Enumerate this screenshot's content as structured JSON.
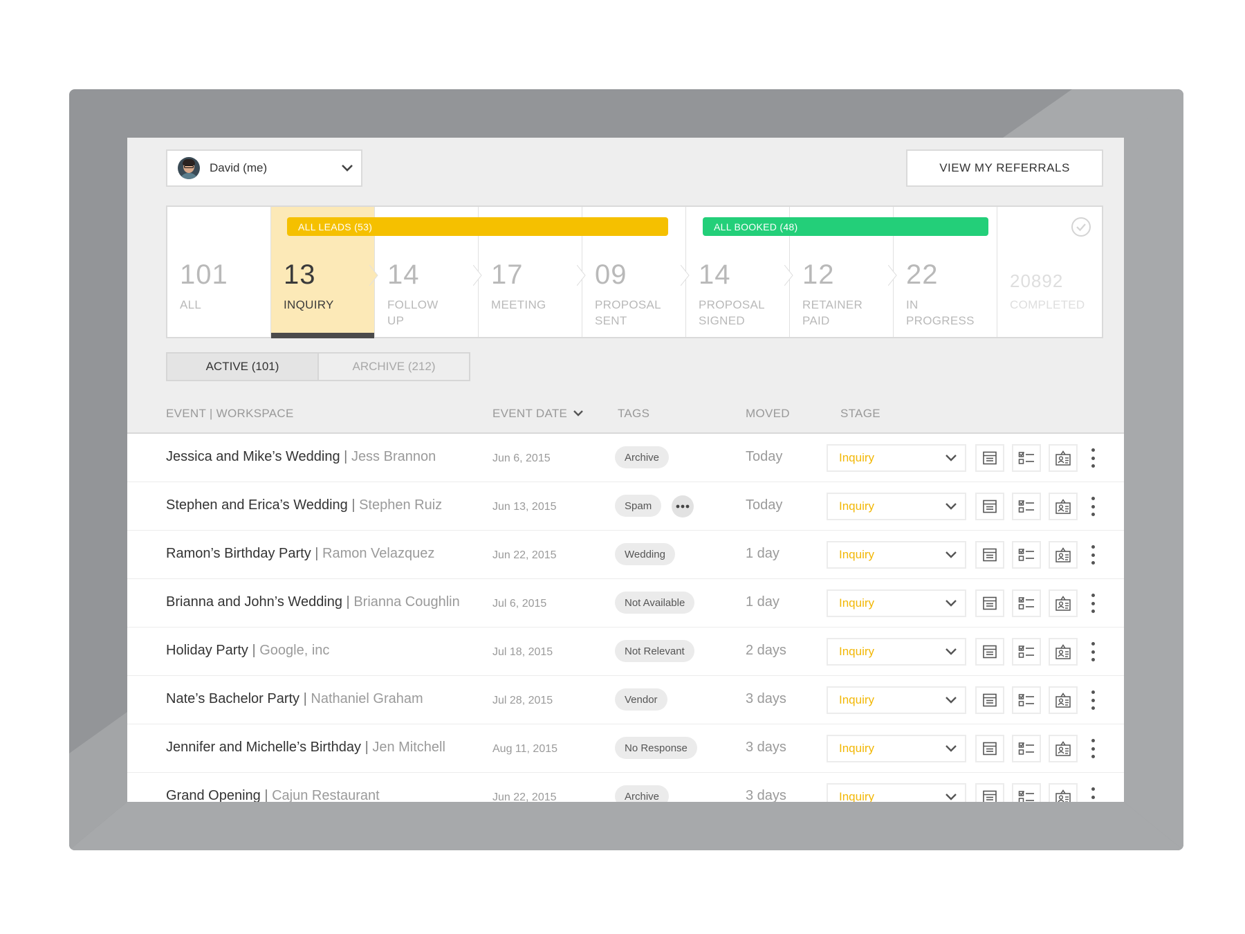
{
  "user": {
    "name": "David (me)"
  },
  "header": {
    "referrals_label": "VIEW MY REFERRALS"
  },
  "groups": {
    "leads": "ALL LEADS (53)",
    "booked": "ALL BOOKED (48)"
  },
  "stages": [
    {
      "count": "101",
      "label": "ALL"
    },
    {
      "count": "13",
      "label": "INQUIRY"
    },
    {
      "count": "14",
      "label": "FOLLOW UP"
    },
    {
      "count": "17",
      "label": "MEETING"
    },
    {
      "count": "09",
      "label": "PROPOSAL SENT"
    },
    {
      "count": "14",
      "label": "PROPOSAL SIGNED"
    },
    {
      "count": "12",
      "label": "RETAINER PAID"
    },
    {
      "count": "22",
      "label": "IN PROGRESS"
    },
    {
      "count": "20892",
      "label": "COMPLETED"
    }
  ],
  "toggle": {
    "active": "ACTIVE (101)",
    "archive": "ARCHIVE (212)"
  },
  "columns": {
    "event": "EVENT | WORKSPACE",
    "date": "EVENT DATE",
    "tags": "TAGS",
    "moved": "MOVED",
    "stage": "STAGE"
  },
  "rows": [
    {
      "event": "Jessica and Mike’s Wedding",
      "sep": " | ",
      "workspace": "Jess Brannon",
      "date": "Jun 6, 2015",
      "tag": "Archive",
      "moved": "Today",
      "stage": "Inquiry"
    },
    {
      "event": "Stephen and Erica’s Wedding",
      "sep": " | ",
      "workspace": "Stephen Ruiz",
      "date": "Jun 13, 2015",
      "tag": "Spam",
      "moved": "Today",
      "stage": "Inquiry"
    },
    {
      "event": "Ramon’s Birthday Party",
      "sep": " | ",
      "workspace": "Ramon Velazquez",
      "date": "Jun 22, 2015",
      "tag": "Wedding",
      "moved": "1 day",
      "stage": "Inquiry"
    },
    {
      "event": "Brianna and John’s Wedding",
      "sep": " | ",
      "workspace": "Brianna Coughlin",
      "date": "Jul 6, 2015",
      "tag": "Not Available",
      "moved": "1 day",
      "stage": "Inquiry"
    },
    {
      "event": "Holiday Party",
      "sep": " | ",
      "workspace": "Google, inc",
      "date": "Jul 18, 2015",
      "tag": "Not Relevant",
      "moved": "2 days",
      "stage": "Inquiry"
    },
    {
      "event": "Nate’s Bachelor Party",
      "sep": " | ",
      "workspace": "Nathaniel Graham",
      "date": "Jul 28, 2015",
      "tag": "Vendor",
      "moved": "3 days",
      "stage": "Inquiry"
    },
    {
      "event": "Jennifer and Michelle’s Birthday",
      "sep": " | ",
      "workspace": "Jen Mitchell",
      "date": "Aug 11, 2015",
      "tag": "No Response",
      "moved": "3 days",
      "stage": "Inquiry"
    },
    {
      "event": "Grand Opening",
      "sep": " | ",
      "workspace": "Cajun Restaurant",
      "date": "Jun 22, 2015",
      "tag": "Archive",
      "moved": "3 days",
      "stage": "Inquiry"
    }
  ],
  "colors": {
    "accent_yellow": "#f5c000",
    "accent_green": "#23cf79",
    "active_stage_bg": "#fce9b7",
    "stage_text": "#f2b705"
  },
  "icons": {
    "user_chevron": "chevron-down-icon",
    "sort": "chevron-down-icon",
    "completed": "check-circle-icon",
    "action1": "archive-box-icon",
    "action2": "checklist-icon",
    "action3": "contact-card-icon",
    "more": "kebab-icon",
    "tag_more": "ellipsis-icon"
  }
}
